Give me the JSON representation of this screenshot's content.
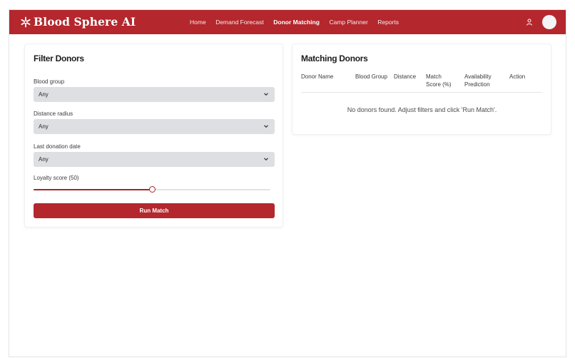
{
  "header": {
    "brand": "Blood Sphere AI",
    "nav": [
      {
        "label": "Home",
        "active": false
      },
      {
        "label": "Demand Forecast",
        "active": false
      },
      {
        "label": "Donor Matching",
        "active": true
      },
      {
        "label": "Camp Planner",
        "active": false
      },
      {
        "label": "Reports",
        "active": false
      }
    ],
    "user_icon": "user-icon",
    "brand_icon": "asterisk-icon"
  },
  "filter": {
    "title": "Filter Donors",
    "blood_group": {
      "label": "Blood group",
      "value": "Any"
    },
    "distance_radius": {
      "label": "Distance radius",
      "value": "Any"
    },
    "last_donation": {
      "label": "Last donation date",
      "value": "Any"
    },
    "loyalty": {
      "label": "Loyalty score (50)",
      "value": 50,
      "min": 0,
      "max": 100
    },
    "run_button": "Run Match"
  },
  "results": {
    "title": "Matching Donors",
    "columns": [
      "Donor Name",
      "Blood Group",
      "Distance",
      "Match\nScore (%)",
      "Availability\nPrediction",
      "Action"
    ],
    "empty_message": "No donors found. Adjust filters and click 'Run Match'."
  },
  "colors": {
    "brand": "#b3272d",
    "select_bg": "#dddfe3"
  }
}
